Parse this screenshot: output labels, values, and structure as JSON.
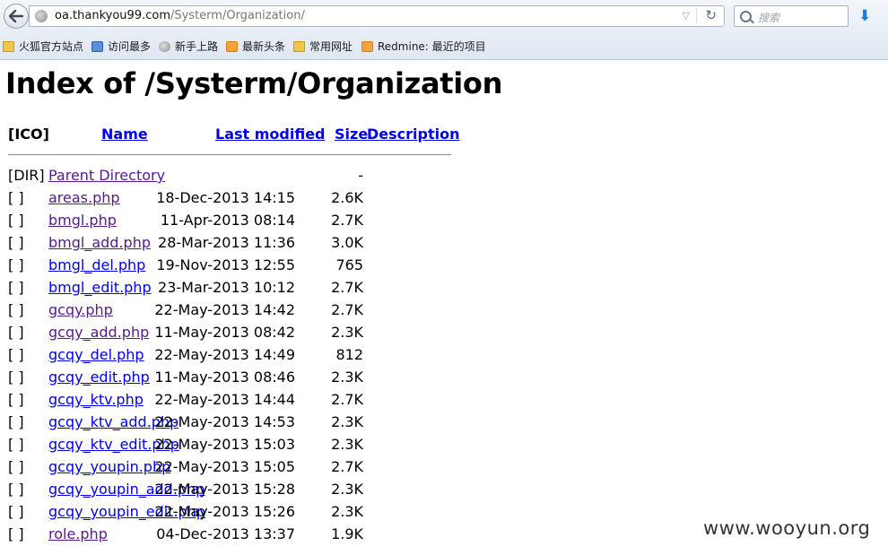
{
  "browser": {
    "url_host": "oa.thankyou99.com",
    "url_path": "/Systerm/Organization/",
    "search_placeholder": "搜索",
    "bookmarks": [
      {
        "label": "火狐官方站点",
        "icon": "folder-icon"
      },
      {
        "label": "访问最多",
        "icon": "bookmark-book-icon"
      },
      {
        "label": "新手上路",
        "icon": "globe-icon"
      },
      {
        "label": "最新头条",
        "icon": "rss-icon"
      },
      {
        "label": "常用网址",
        "icon": "folder-icon"
      },
      {
        "label": "Redmine: 最近的项目",
        "icon": "rss-icon"
      }
    ]
  },
  "page": {
    "title": "Index of /Systerm/Organization",
    "headers": {
      "ico": "[ICO]",
      "name": "Name",
      "last_modified": "Last modified",
      "size": "Size",
      "description": "Description"
    },
    "rows": [
      {
        "ico": "[DIR]",
        "name": "Parent Directory",
        "date": "",
        "size": "-",
        "visited": true
      },
      {
        "ico": "[ ]",
        "name": "areas.php",
        "date": "18-Dec-2013 14:15",
        "size": "2.6K",
        "visited": true
      },
      {
        "ico": "[ ]",
        "name": "bmgl.php",
        "date": "11-Apr-2013 08:14",
        "size": "2.7K",
        "visited": true
      },
      {
        "ico": "[ ]",
        "name": "bmgl_add.php",
        "date": "28-Mar-2013 11:36",
        "size": "3.0K",
        "visited": true
      },
      {
        "ico": "[ ]",
        "name": "bmgl_del.php",
        "date": "19-Nov-2013 12:55",
        "size": "765",
        "visited": false
      },
      {
        "ico": "[ ]",
        "name": "bmgl_edit.php",
        "date": "23-Mar-2013 10:12",
        "size": "2.7K",
        "visited": false
      },
      {
        "ico": "[ ]",
        "name": "gcqy.php",
        "date": "22-May-2013 14:42",
        "size": "2.7K",
        "visited": true
      },
      {
        "ico": "[ ]",
        "name": "gcqy_add.php",
        "date": "11-May-2013 08:42",
        "size": "2.3K",
        "visited": true
      },
      {
        "ico": "[ ]",
        "name": "gcqy_del.php",
        "date": "22-May-2013 14:49",
        "size": "812",
        "visited": false
      },
      {
        "ico": "[ ]",
        "name": "gcqy_edit.php",
        "date": "11-May-2013 08:46",
        "size": "2.3K",
        "visited": false
      },
      {
        "ico": "[ ]",
        "name": "gcqy_ktv.php",
        "date": "22-May-2013 14:44",
        "size": "2.7K",
        "visited": false
      },
      {
        "ico": "[ ]",
        "name": "gcqy_ktv_add.php",
        "date": "22-May-2013 14:53",
        "size": "2.3K",
        "visited": false
      },
      {
        "ico": "[ ]",
        "name": "gcqy_ktv_edit.php",
        "date": "22-May-2013 15:03",
        "size": "2.3K",
        "visited": false
      },
      {
        "ico": "[ ]",
        "name": "gcqy_youpin.php",
        "date": "22-May-2013 15:05",
        "size": "2.7K",
        "visited": false
      },
      {
        "ico": "[ ]",
        "name": "gcqy_youpin_add.php",
        "date": "22-May-2013 15:28",
        "size": "2.3K",
        "visited": false
      },
      {
        "ico": "[ ]",
        "name": "gcqy_youpin_edit.php",
        "date": "22-May-2013 15:26",
        "size": "2.3K",
        "visited": false
      },
      {
        "ico": "[ ]",
        "name": "role.php",
        "date": "04-Dec-2013 13:37",
        "size": "1.9K",
        "visited": true
      }
    ]
  },
  "watermark": "www.wooyun.org"
}
